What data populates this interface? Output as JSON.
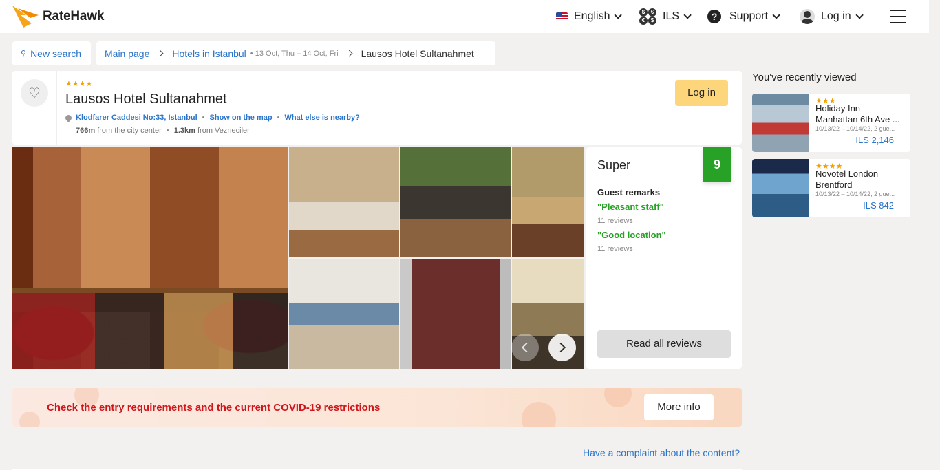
{
  "header": {
    "brand": "RateHawk",
    "language": "English",
    "currency": "ILS",
    "support": "Support",
    "login": "Log in"
  },
  "breadcrumb": {
    "new_search": "New search",
    "main_page": "Main page",
    "hotels": "Hotels in Istanbul",
    "dates": "13 Oct, Thu – 14 Oct, Fri",
    "current": "Lausos Hotel Sultanahmet"
  },
  "hotel": {
    "stars": "★★★★",
    "name": "Lausos Hotel Sultanahmet",
    "address": "Klodfarer Caddesi No:33, Istanbul",
    "map_link": "Show on the map",
    "nearby_link": "What else is nearby?",
    "dist_center_value": "766m",
    "dist_center_label": "from the city center",
    "dist_stop_value": "1.3km",
    "dist_stop_label": "from Vezneciler",
    "login_button": "Log in"
  },
  "rating": {
    "word": "Super",
    "score": "9",
    "remarks_title": "Guest remarks",
    "remarks": [
      {
        "text": "\"Pleasant staff\"",
        "count": "11 reviews"
      },
      {
        "text": "\"Good location\"",
        "count": "11 reviews"
      }
    ],
    "read_all": "Read all reviews"
  },
  "covid": {
    "text": "Check the entry requirements and the current COVID-19 restrictions",
    "button": "More info"
  },
  "complaint": "Have a complaint about the content?",
  "recent": {
    "title": "You've recently viewed",
    "items": [
      {
        "stars": "★★★",
        "name": "Holiday Inn Manhattan 6th Ave ...",
        "meta": "10/13/22 – 10/14/22, 2 gue...",
        "price": "ILS 2,146"
      },
      {
        "stars": "★★★★",
        "name": "Novotel London Brentford",
        "meta": "10/13/22 – 10/14/22, 2 gue...",
        "price": "ILS 842"
      }
    ]
  },
  "colors": {
    "accent_link": "#2a74c9",
    "score_green": "#27a126",
    "login_yellow": "#fdd57b",
    "covid_red": "#d0151b",
    "star_orange": "#f2a100"
  }
}
